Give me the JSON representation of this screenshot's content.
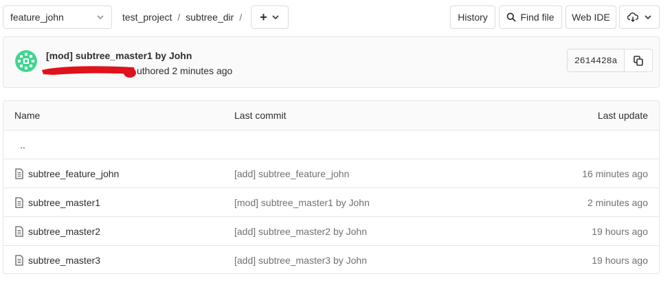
{
  "toolbar": {
    "branch": "feature_john",
    "breadcrumb": [
      "test_project",
      "subtree_dir"
    ],
    "separator": "/",
    "add_label": "+",
    "history_label": "History",
    "find_file_label": "Find file",
    "web_ide_label": "Web IDE"
  },
  "commit": {
    "title": "[mod] subtree_master1 by John",
    "author_suffix": "uthored 2 minutes ago",
    "sha": "2614428a"
  },
  "table": {
    "headers": {
      "name": "Name",
      "last_commit": "Last commit",
      "last_update": "Last update"
    },
    "parent_link": "..",
    "rows": [
      {
        "name": "subtree_feature_john",
        "commit": "[add] subtree_feature_john",
        "updated": "16 minutes ago"
      },
      {
        "name": "subtree_master1",
        "commit": "[mod] subtree_master1 by John",
        "updated": "2 minutes ago"
      },
      {
        "name": "subtree_master2",
        "commit": "[add] subtree_master2 by John",
        "updated": "19 hours ago"
      },
      {
        "name": "subtree_master3",
        "commit": "[add] subtree_master3 by John",
        "updated": "19 hours ago"
      }
    ]
  },
  "colors": {
    "avatar": "#3fd68f",
    "redaction": "#e0121b",
    "border": "#dbdbdb"
  }
}
